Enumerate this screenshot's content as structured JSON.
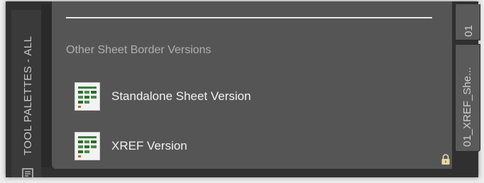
{
  "palette": {
    "title": "TOOL PALETTES - ALL",
    "section_label": "Other Sheet Border Versions",
    "tools": [
      {
        "label": "Standalone Sheet Version",
        "icon": "sheet-thumbnail-icon"
      },
      {
        "label": "XREF Version",
        "icon": "sheet-thumbnail-icon"
      }
    ]
  },
  "tabs": [
    {
      "label": "01"
    },
    {
      "label": "01_XREF_She..."
    }
  ],
  "colors": {
    "frame": "#303030",
    "content": "#555555",
    "tab": "#5a5a5a",
    "text": "#f2f2f2",
    "muted": "#b0b0b0"
  }
}
